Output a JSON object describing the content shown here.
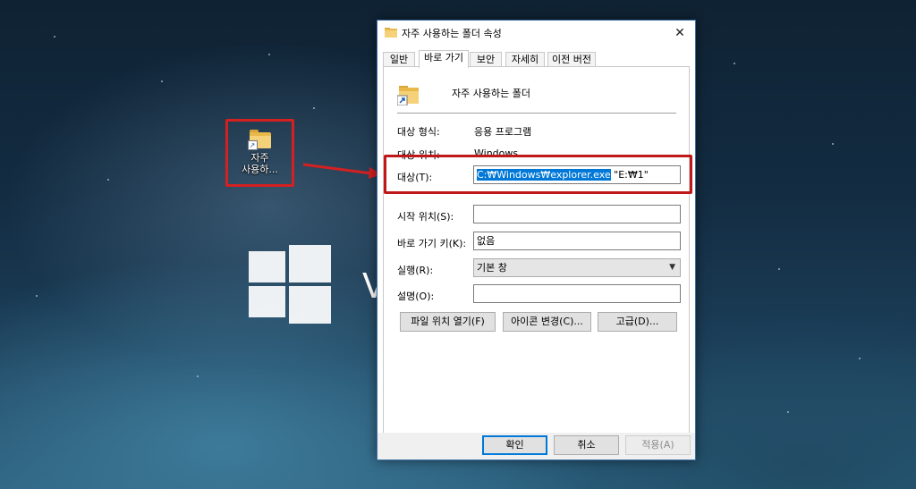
{
  "desktop": {
    "shortcut_icon": {
      "label_line1": "자주",
      "label_line2": "사용하..."
    },
    "windows_logo_text": "V"
  },
  "dialog": {
    "title": "자주 사용하는 폴더 속성",
    "close_glyph": "✕",
    "tabs": [
      {
        "label": "일반"
      },
      {
        "label": "바로 가기"
      },
      {
        "label": "보안"
      },
      {
        "label": "자세히"
      },
      {
        "label": "이전 버전"
      }
    ],
    "active_tab": "바로 가기",
    "shortcut_name": "자주 사용하는 폴더",
    "target_type": {
      "label": "대상 형식:",
      "value": "응용 프로그램"
    },
    "target_location": {
      "label": "대상 위치:",
      "value": "Windows"
    },
    "target": {
      "label": "대상(T):",
      "selected_text": "C:₩Windows₩explorer.exe",
      "rest_text": " \"E:₩1\""
    },
    "start_in": {
      "label": "시작 위치(S):",
      "value": ""
    },
    "shortcut_key": {
      "label": "바로 가기 키(K):",
      "value": "없음"
    },
    "run": {
      "label": "실행(R):",
      "value": "기본 창"
    },
    "comment": {
      "label": "설명(O):",
      "value": ""
    },
    "buttons": {
      "open_location": "파일 위치 열기(F)",
      "change_icon": "아이콘 변경(C)...",
      "advanced": "고급(D)..."
    },
    "footer": {
      "ok": "확인",
      "cancel": "취소",
      "apply": "적용(A)"
    }
  },
  "colors": {
    "highlight_red": "#c01818",
    "selection_blue": "#0078d7",
    "folder_yellow": "#e8b949"
  }
}
